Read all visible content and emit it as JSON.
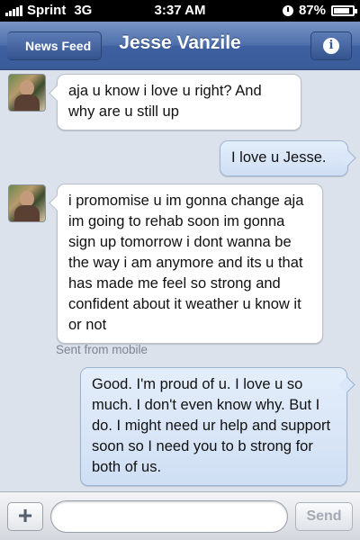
{
  "status_bar": {
    "carrier": "Sprint",
    "network": "3G",
    "time": "3:37 AM",
    "battery": "87%",
    "battery_level": 0.87
  },
  "nav": {
    "back_label": "News Feed",
    "title": "Jesse Vanzile",
    "info_icon": "i"
  },
  "messages": [
    {
      "direction": "incoming",
      "text": "aja u know i love u right? And why are u still up"
    },
    {
      "direction": "outgoing",
      "text": "I love u Jesse."
    },
    {
      "direction": "incoming",
      "text": "i promomise u im gonna change aja im going to rehab soon im gonna sign up tomorrow i dont wanna be the way i am anymore and its u that has made me feel so strong and confident about it weather u know it or not"
    },
    {
      "direction": "outgoing",
      "text": "Good. I'm proud of u. I love u so much. I don't even know why. But I do. I might need ur help and support soon so I need you to b strong for both of us."
    }
  ],
  "sent_from": "Sent from mobile",
  "composer": {
    "plus_label": "+",
    "input_value": "",
    "send_label": "Send"
  },
  "colors": {
    "nav_blue": "#3b5c9a",
    "outgoing_bubble": "#d9e6f7",
    "background": "#dbe2ec"
  }
}
